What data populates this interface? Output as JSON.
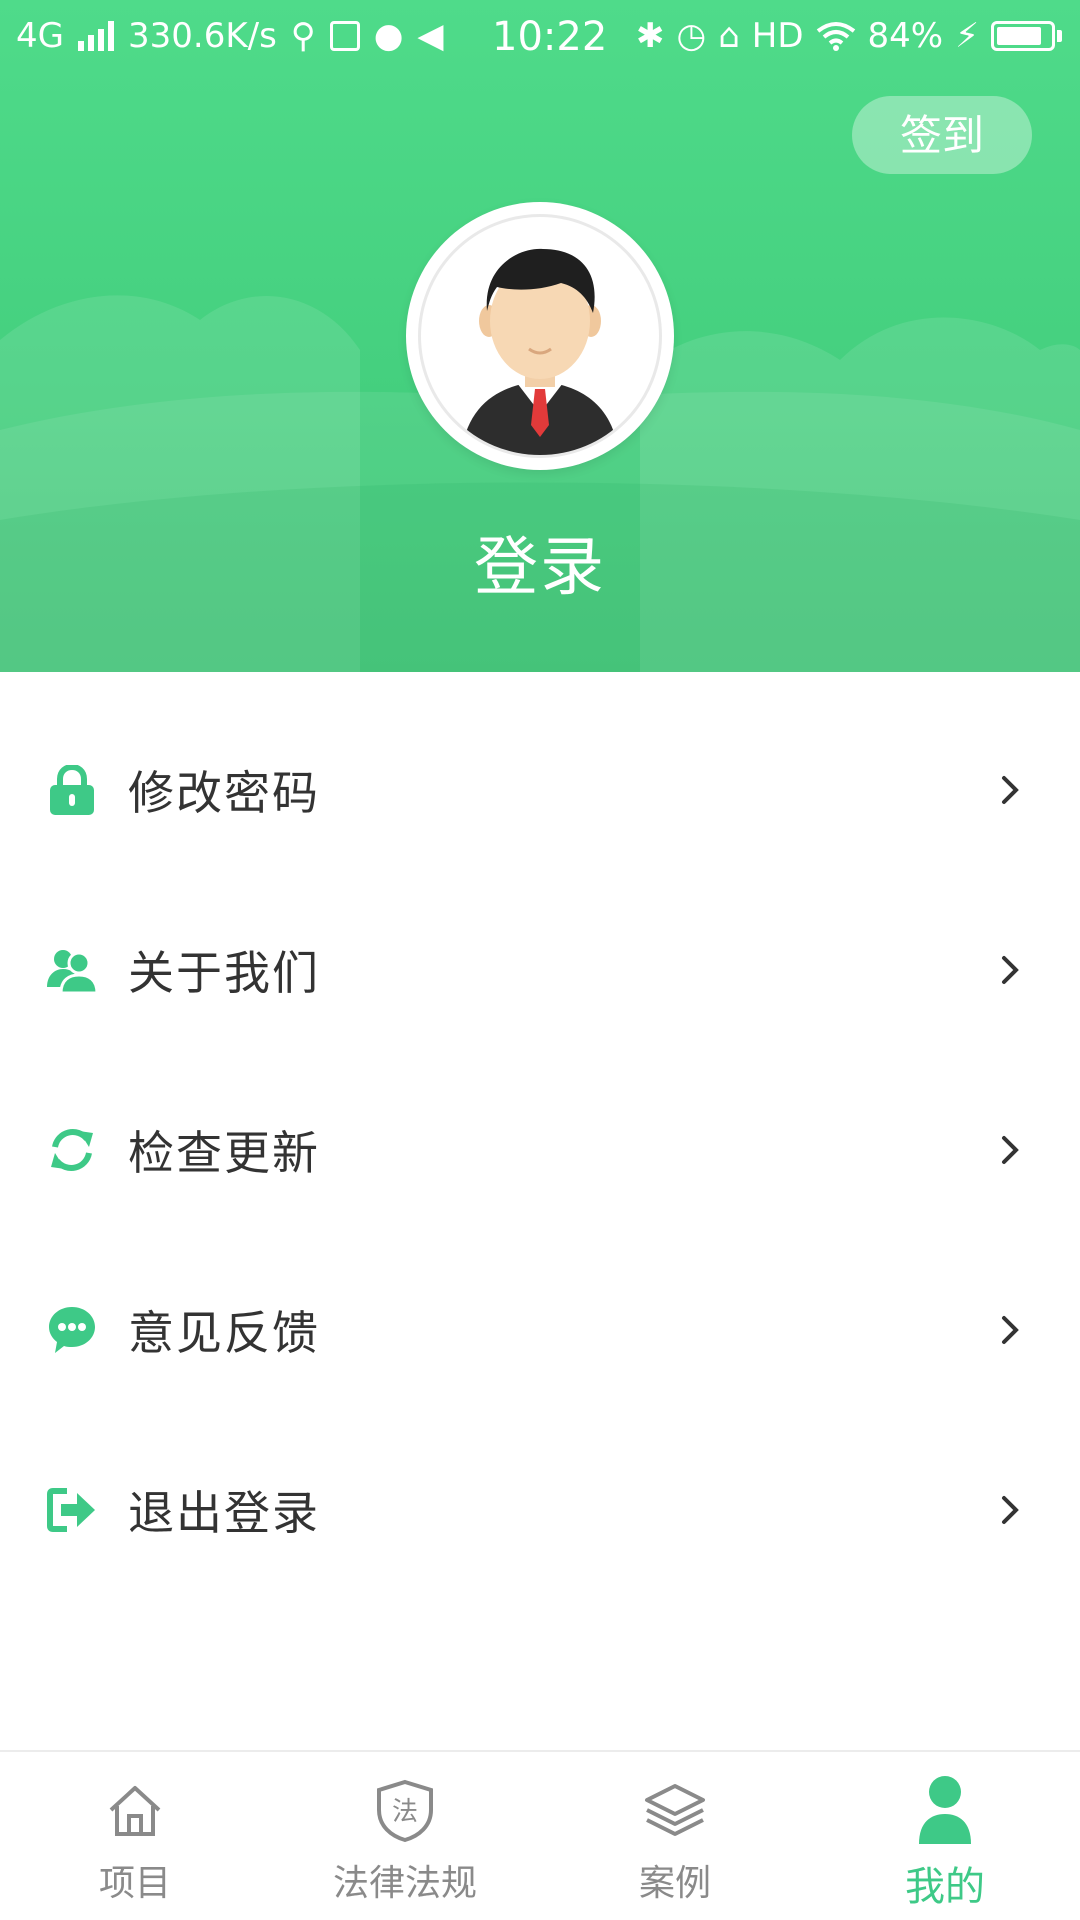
{
  "status_bar": {
    "network": "4G",
    "speed": "330.6K/s",
    "time": "10:22",
    "hd": "HD",
    "battery_percent": "84%",
    "battery_level": 0.84
  },
  "header": {
    "signin_label": "签到",
    "login_label": "登录",
    "accent_color": "#45d07f"
  },
  "menu": {
    "items": [
      {
        "label": "修改密码",
        "icon": "lock-icon"
      },
      {
        "label": "关于我们",
        "icon": "users-icon"
      },
      {
        "label": "检查更新",
        "icon": "refresh-icon"
      },
      {
        "label": "意见反馈",
        "icon": "chat-icon"
      },
      {
        "label": "退出登录",
        "icon": "logout-icon"
      }
    ]
  },
  "tabbar": {
    "tabs": [
      {
        "label": "项目",
        "icon": "home-icon",
        "active": false
      },
      {
        "label": "法律法规",
        "icon": "law-shield-icon",
        "active": false
      },
      {
        "label": "案例",
        "icon": "layers-icon",
        "active": false
      },
      {
        "label": "我的",
        "icon": "person-icon",
        "active": true
      }
    ],
    "active_color": "#3ec987"
  }
}
